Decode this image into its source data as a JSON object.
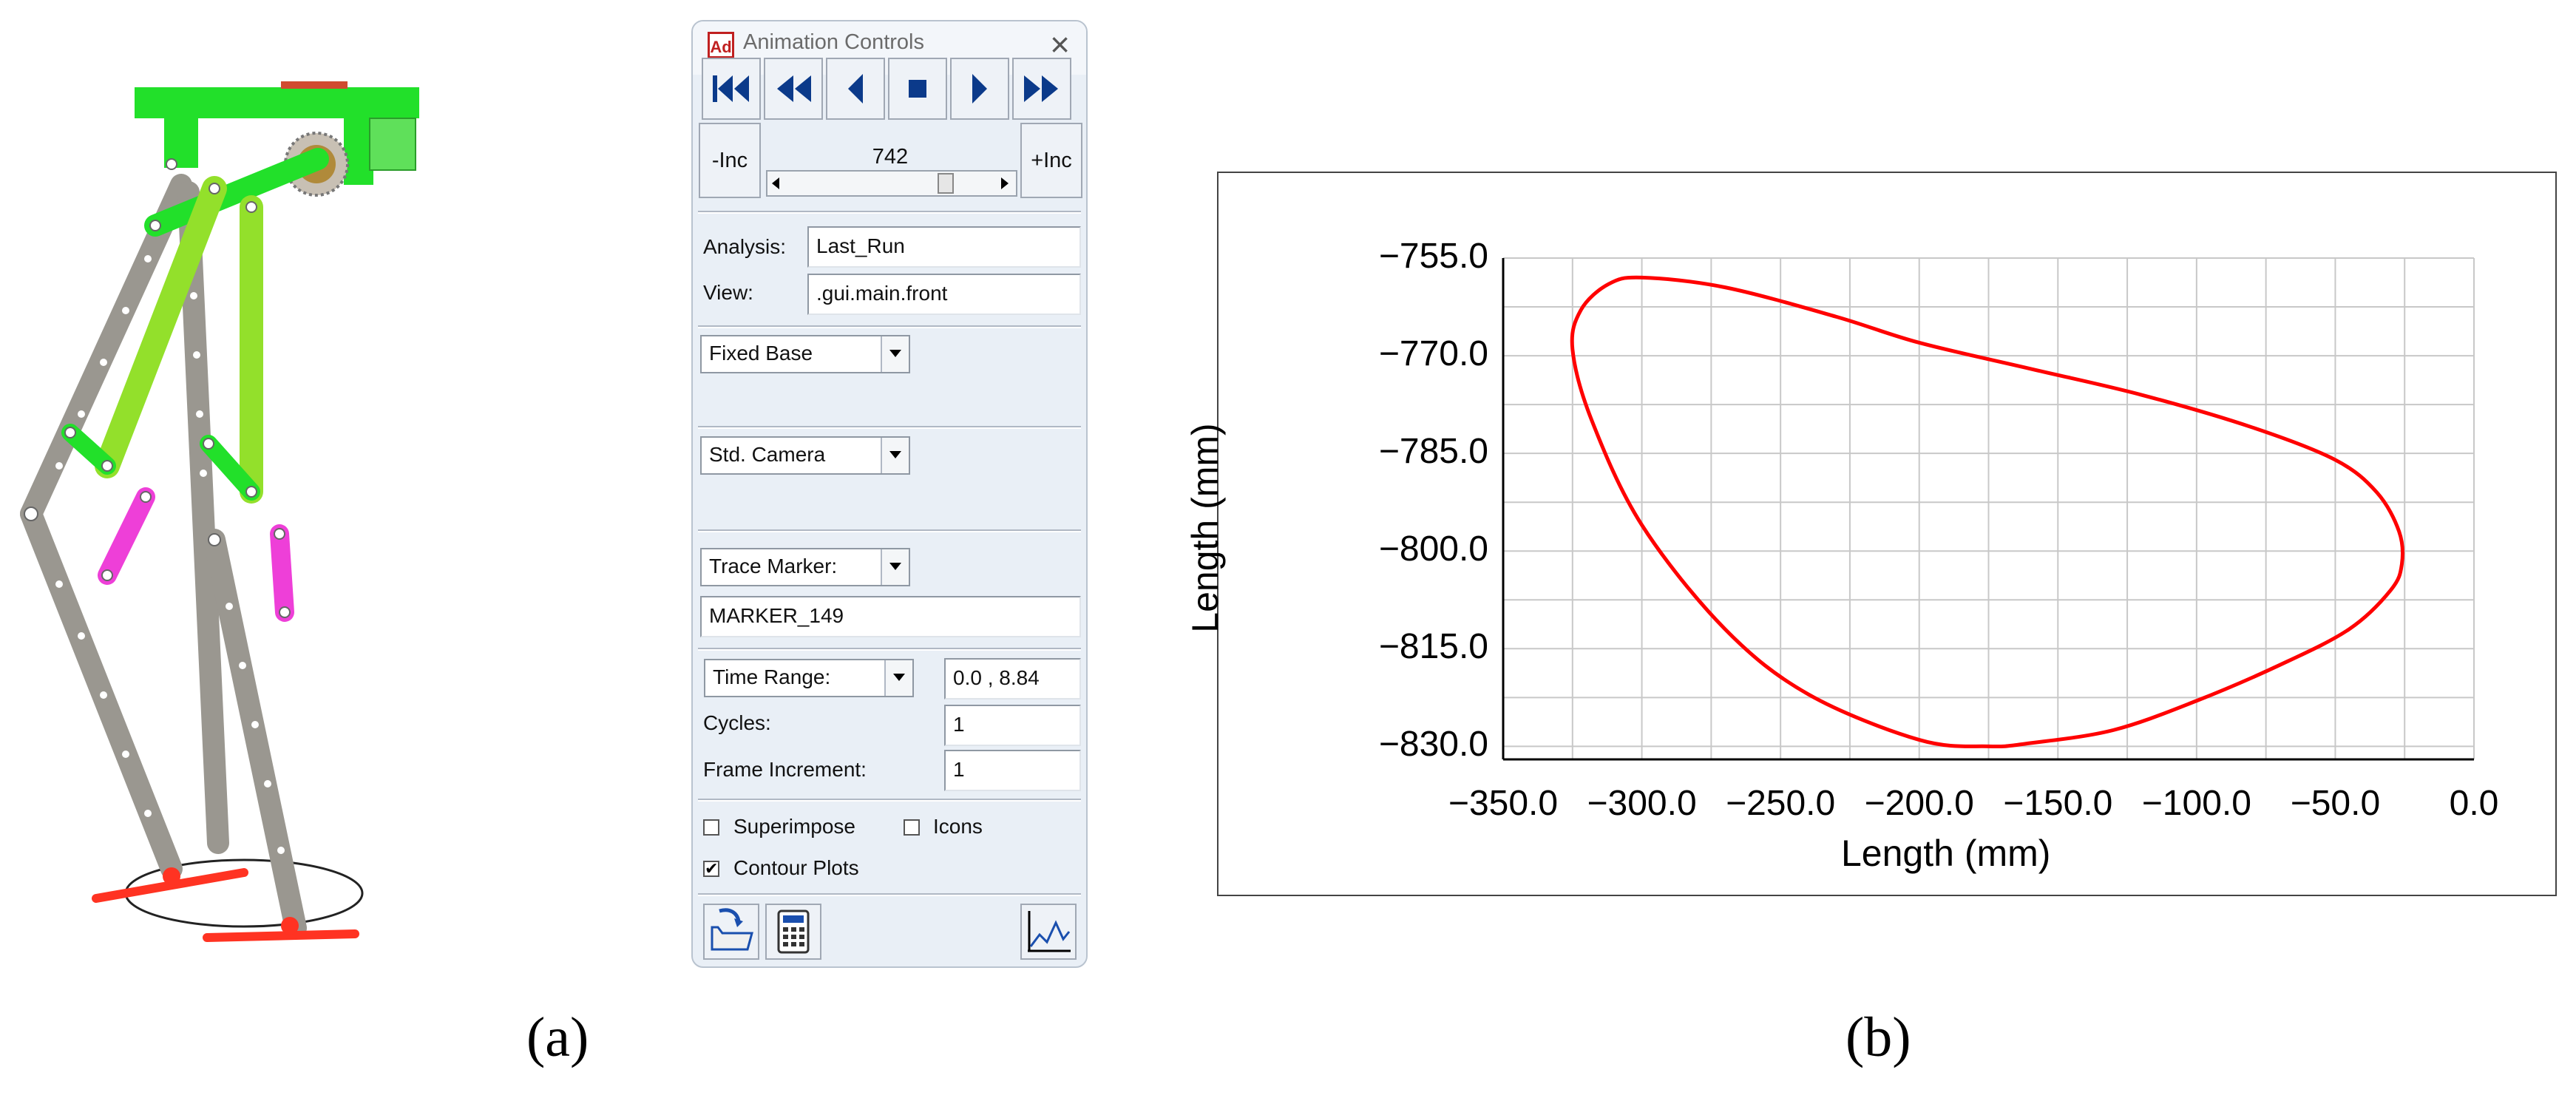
{
  "panel": {
    "title": "Animation Controls",
    "logo_text": "Ad",
    "transport": {
      "icons": [
        "skip-to-start-icon",
        "rewind-icon",
        "step-back-icon",
        "stop-icon",
        "play-icon",
        "fast-forward-icon"
      ]
    },
    "minus_inc_label": "-Inc",
    "plus_inc_label": "+Inc",
    "frame_value": "742",
    "analysis_label": "Analysis:",
    "analysis_value": "Last_Run",
    "view_label": "View:",
    "view_value": ".gui.main.front",
    "base_select": "Fixed Base",
    "camera_select": "Std. Camera",
    "trace_select": "Trace Marker:",
    "trace_value": "MARKER_149",
    "time_select": "Time Range:",
    "time_value": "0.0 , 8.84",
    "cycles_label": "Cycles:",
    "cycles_value": "1",
    "frame_inc_label": "Frame Increment:",
    "frame_inc_value": "1",
    "superimpose_label": "Superimpose",
    "icons_label": "Icons",
    "contour_label": "Contour Plots",
    "checkbox_states": {
      "superimpose": false,
      "icons": false,
      "contour_plots": true
    }
  },
  "captions": {
    "a": "(a)",
    "b": "(b)"
  },
  "colors": {
    "curve": "#ff0000",
    "grid": "#c8c8c8",
    "link_gray": "#9a9790",
    "link_green": "#22e02a",
    "link_lime": "#93e02b",
    "link_magenta": "#ee3fd8",
    "foot_red": "#ff3322"
  },
  "chart_data": {
    "type": "line",
    "xlabel": "Length (mm)",
    "ylabel": "Length (mm)",
    "xlim": [
      -350,
      0
    ],
    "ylim": [
      -832,
      -755
    ],
    "xticks": [
      "−350.0",
      "−300.0",
      "−250.0",
      "−200.0",
      "−150.0",
      "−100.0",
      "−50.0",
      "0.0"
    ],
    "xtick_values": [
      -350,
      -300,
      -250,
      -200,
      -150,
      -100,
      -50,
      0
    ],
    "yticks": [
      "−755.0",
      "−770.0",
      "−785.0",
      "−800.0",
      "−815.0",
      "−830.0"
    ],
    "ytick_values": [
      -755,
      -770,
      -785,
      -800,
      -815,
      -830
    ],
    "grid": true,
    "series": [
      {
        "closed": true,
        "x": [
          -300,
          -270,
          -230,
          -200,
          -160,
          -120,
          -80,
          -50,
          -35,
          -27,
          -26,
          -30,
          -45,
          -70,
          -100,
          -130,
          -160,
          -175,
          -200,
          -240,
          -270,
          -300,
          -318,
          -325,
          -322,
          -312,
          -300
        ],
        "y": [
          -758,
          -759.5,
          -764,
          -768,
          -772,
          -776,
          -781,
          -786,
          -791,
          -797,
          -802,
          -806,
          -812,
          -817.5,
          -823,
          -827.5,
          -829.5,
          -830,
          -829,
          -822,
          -812,
          -796,
          -780,
          -769,
          -763,
          -759,
          -758
        ]
      }
    ]
  }
}
